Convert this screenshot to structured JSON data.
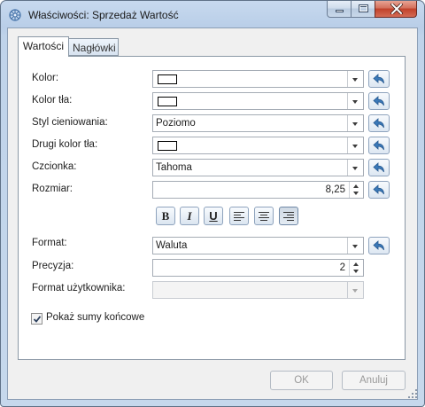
{
  "window": {
    "title": "Właściwości: Sprzedaż Wartość"
  },
  "tabs": [
    {
      "label": "Wartości",
      "active": true
    },
    {
      "label": "Nagłówki",
      "active": false
    }
  ],
  "fields": {
    "kolor": {
      "label": "Kolor:",
      "value": ""
    },
    "kolor_tla": {
      "label": "Kolor tła:",
      "value": ""
    },
    "styl": {
      "label": "Styl cieniowania:",
      "value": "Poziomo"
    },
    "drugi_kolor": {
      "label": "Drugi kolor tła:",
      "value": ""
    },
    "czcionka": {
      "label": "Czcionka:",
      "value": "Tahoma"
    },
    "rozmiar": {
      "label": "Rozmiar:",
      "value": "8,25"
    },
    "format": {
      "label": "Format:",
      "value": "Waluta"
    },
    "precyzja": {
      "label": "Precyzja:",
      "value": "2"
    },
    "format_uzytkownika": {
      "label": "Format użytkownika:",
      "value": ""
    }
  },
  "format_buttons": {
    "bold": "B",
    "italic": "I",
    "underline": "U",
    "active_alignment": "right"
  },
  "checkbox": {
    "label": "Pokaż sumy końcowe",
    "checked": true
  },
  "buttons": {
    "ok": "OK",
    "cancel": "Anuluj"
  },
  "colors": {
    "swatch": "#ffffff",
    "accent": "#3b79b8"
  }
}
